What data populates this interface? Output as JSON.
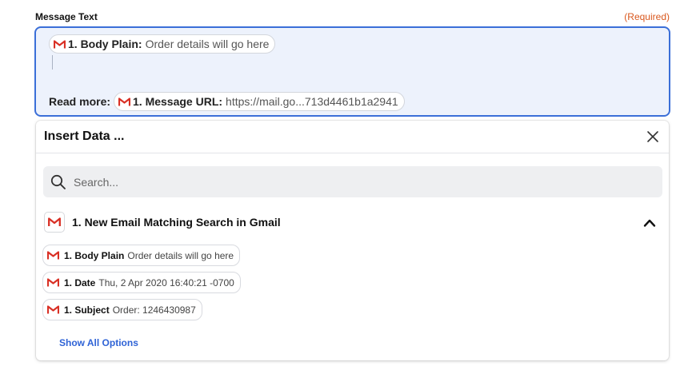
{
  "field": {
    "label": "Message Text",
    "required": "(Required)"
  },
  "editor": {
    "line1_pill": {
      "icon": "gmail-icon",
      "key": "1. Body Plain:",
      "value": "Order details will go here"
    },
    "read_more_label": "Read more:",
    "line2_pill": {
      "icon": "gmail-icon",
      "key": "1. Message URL:",
      "value": "https://mail.go...713d4461b1a2941"
    }
  },
  "insert_panel": {
    "title": "Insert Data ...",
    "close_icon": "close-icon",
    "search": {
      "placeholder": "Search...",
      "value": "",
      "icon": "search-icon"
    },
    "group": {
      "title": "1. New Email Matching Search in Gmail",
      "icon": "gmail-icon",
      "expanded": true
    },
    "items": [
      {
        "key": "1. Body Plain",
        "value": "Order details will go here"
      },
      {
        "key": "1. Date",
        "value": "Thu, 2 Apr 2020 16:40:21 -0700"
      },
      {
        "key": "1. Subject",
        "value": "Order: 1246430987"
      }
    ],
    "show_all_label": "Show All Options"
  },
  "colors": {
    "accent_blue": "#3b6fd8",
    "required_orange": "#d9581e",
    "link_blue": "#2f63d6",
    "gmail_red": "#d93025"
  }
}
